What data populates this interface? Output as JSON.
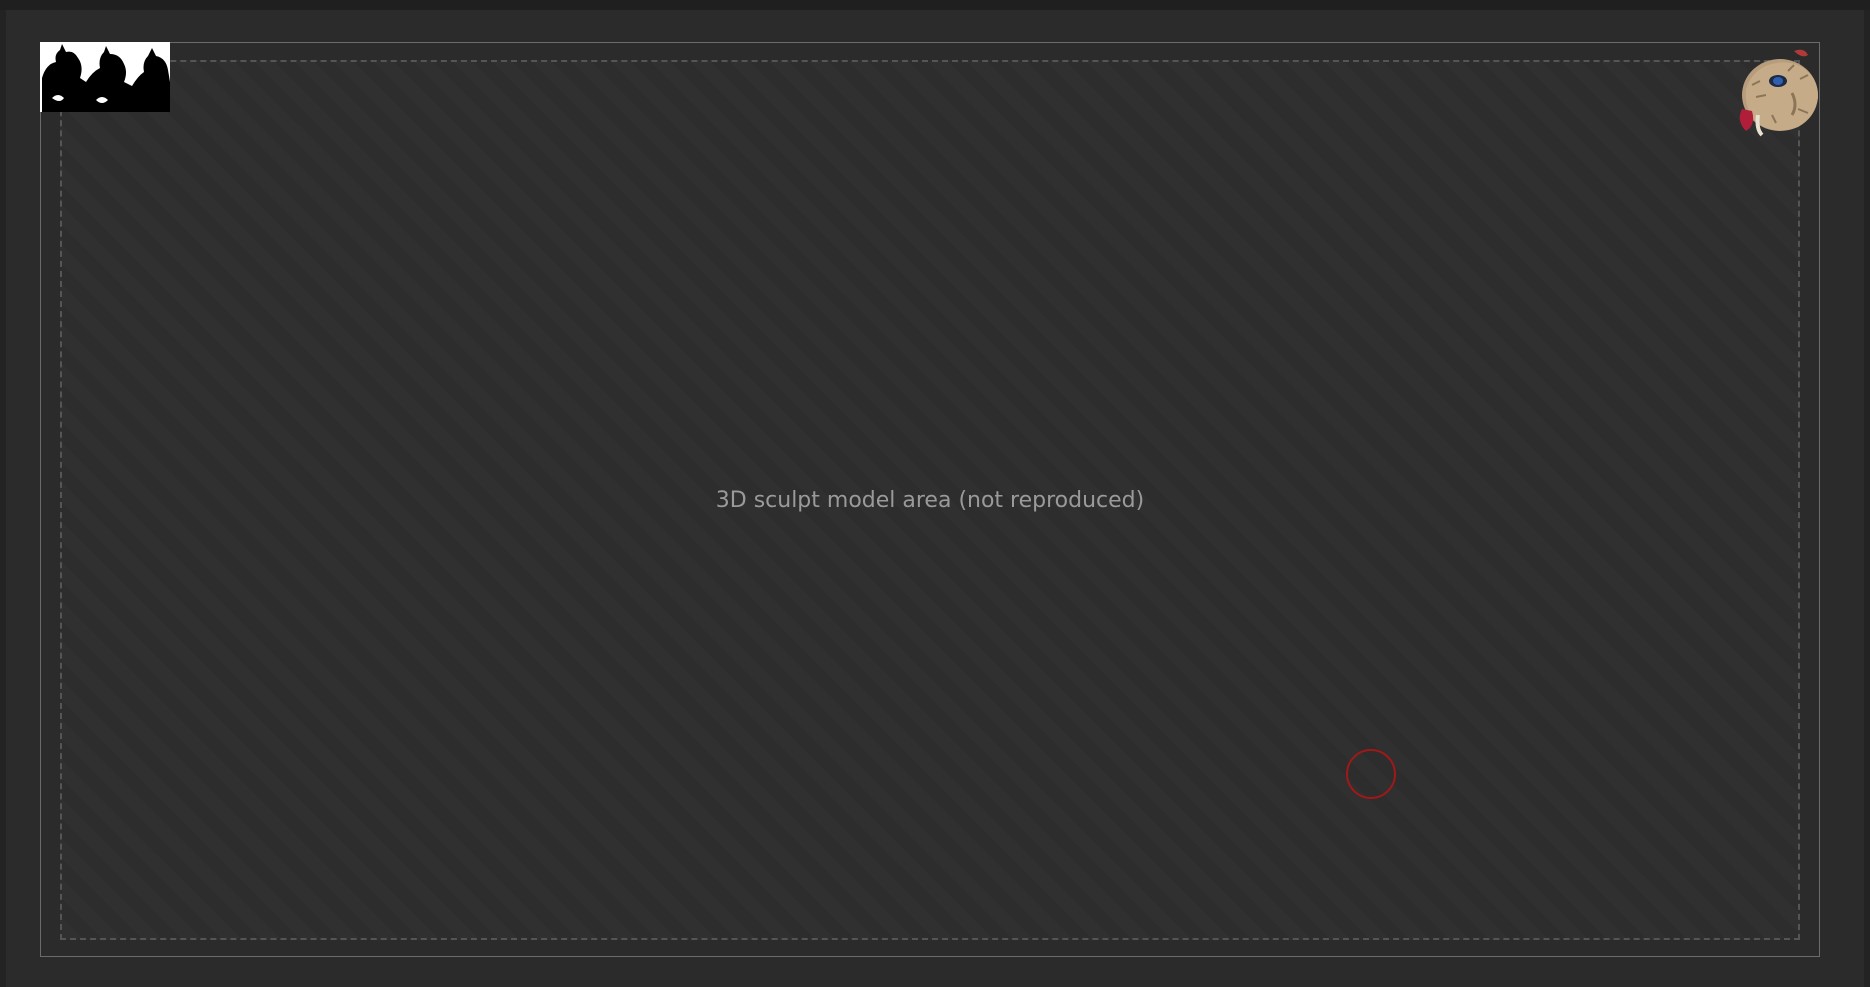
{
  "viewport": {
    "background_color": "#2b2b2b",
    "frame_guide_color": "#6b6b6b",
    "brush_cursor_color": "#a01818"
  },
  "model": {
    "omitted_note": "3D sculpt model area (not reproduced)"
  },
  "thumbnails": {
    "left_icon": "silhouette-thumbnail-icon",
    "right_icon": "boar-head-thumbnail-icon"
  },
  "cursor": {
    "icon": "brush-cursor-icon"
  }
}
